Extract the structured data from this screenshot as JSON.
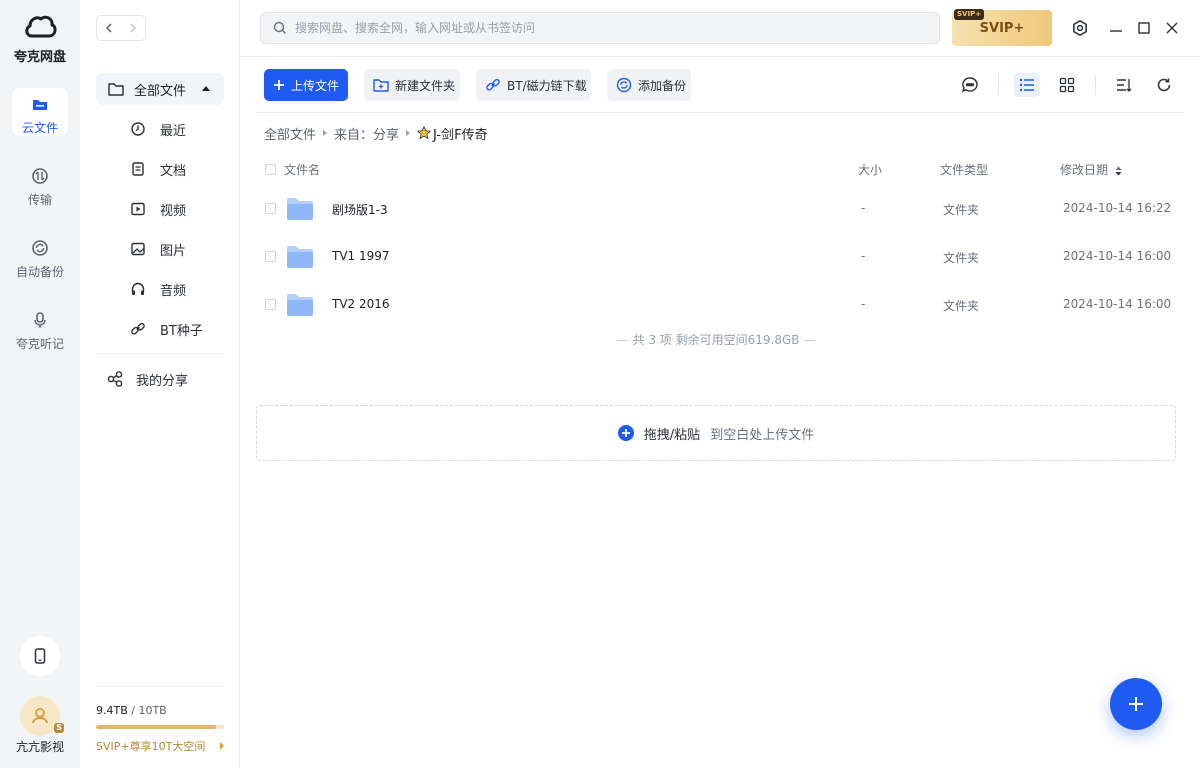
{
  "app": {
    "brand_name": "夸克网盘",
    "user_name": "亢亢影视"
  },
  "rail": {
    "items": [
      {
        "label": "云文件",
        "icon": "cloud-file-icon",
        "active": true
      },
      {
        "label": "传输",
        "icon": "transfer-icon",
        "active": false
      },
      {
        "label": "自动备份",
        "icon": "auto-backup-icon",
        "active": false
      },
      {
        "label": "夸克听记",
        "icon": "microphone-icon",
        "active": false
      }
    ],
    "avatar_badge": "SVIP"
  },
  "sidebar": {
    "all_files_label": "全部文件",
    "sub_items": [
      {
        "label": "最近",
        "icon": "clock-icon"
      },
      {
        "label": "文档",
        "icon": "document-icon"
      },
      {
        "label": "视频",
        "icon": "video-icon"
      },
      {
        "label": "图片",
        "icon": "image-icon"
      },
      {
        "label": "音频",
        "icon": "headphones-icon"
      },
      {
        "label": "BT种子",
        "icon": "link-icon"
      }
    ],
    "share_label": "我的分享",
    "quota_used": "9.4TB",
    "quota_total": " / 10TB",
    "quota_fraction": 0.94,
    "promo_text": "SVIP+尊享10T大空间"
  },
  "topbar": {
    "search_placeholder": "搜索网盘、搜索全网，输入网址或从书签访问",
    "svip_label": "SVIP+",
    "svip_tag": "SVIP+"
  },
  "toolbar": {
    "upload_label": "上传文件",
    "new_folder_label": "新建文件夹",
    "bt_label": "BT/磁力链下载",
    "backup_label": "添加备份"
  },
  "breadcrumb": {
    "root": "全部文件",
    "from": "来自：分享",
    "current": "J-剑F传奇"
  },
  "table": {
    "headers": {
      "name": "文件名",
      "size": "大小",
      "type": "文件类型",
      "date": "修改日期"
    },
    "rows": [
      {
        "name": "剧场版1-3",
        "size": "-",
        "type": "文件夹",
        "date": "2024-10-14 16:22"
      },
      {
        "name": "TV1 1997",
        "size": "-",
        "type": "文件夹",
        "date": "2024-10-14 16:00"
      },
      {
        "name": "TV2 2016",
        "size": "-",
        "type": "文件夹",
        "date": "2024-10-14 16:00"
      }
    ],
    "summary": "共 3 项 剩余可用空间619.8GB"
  },
  "dropzone": {
    "main": "拖拽/粘贴",
    "sub": "到空白处上传文件"
  },
  "colors": {
    "accent": "#1f5bf2",
    "folder": "#8fb6f7",
    "gold": "#f0c979"
  }
}
